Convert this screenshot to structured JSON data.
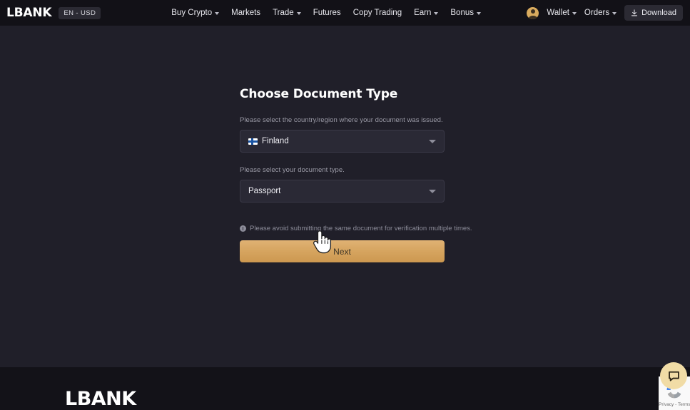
{
  "header": {
    "brand": "LBANK",
    "lang_badge": "EN - USD",
    "nav": [
      {
        "label": "Buy Crypto",
        "has_chevron": true
      },
      {
        "label": "Markets",
        "has_chevron": false
      },
      {
        "label": "Trade",
        "has_chevron": true
      },
      {
        "label": "Futures",
        "has_chevron": false
      },
      {
        "label": "Copy Trading",
        "has_chevron": false
      },
      {
        "label": "Earn",
        "has_chevron": true
      },
      {
        "label": "Bonus",
        "has_chevron": true
      }
    ],
    "wallet_label": "Wallet",
    "orders_label": "Orders",
    "download_label": "Download",
    "avatar_name": "user-avatar"
  },
  "main": {
    "title": "Choose Document Type",
    "country_label": "Please select the country/region where your document was issued.",
    "country_value": "Finland",
    "country_flag": "fi-flag-icon",
    "doc_type_label": "Please select your document type.",
    "doc_type_value": "Passport",
    "notice": "Please avoid submitting the same document for verification multiple times.",
    "next_label": "Next"
  },
  "footer": {
    "logo": "LBANK"
  },
  "widgets": {
    "recaptcha_text": "Privacy - Terms",
    "chat_icon": "chat-bubble-icon"
  },
  "colors": {
    "page_bg": "#201F29",
    "header_bg": "#121117",
    "footer_bg": "#131218",
    "accent_gold": "#d6a45f",
    "field_bg": "#2a2935",
    "muted_text": "#8d8d9a"
  }
}
